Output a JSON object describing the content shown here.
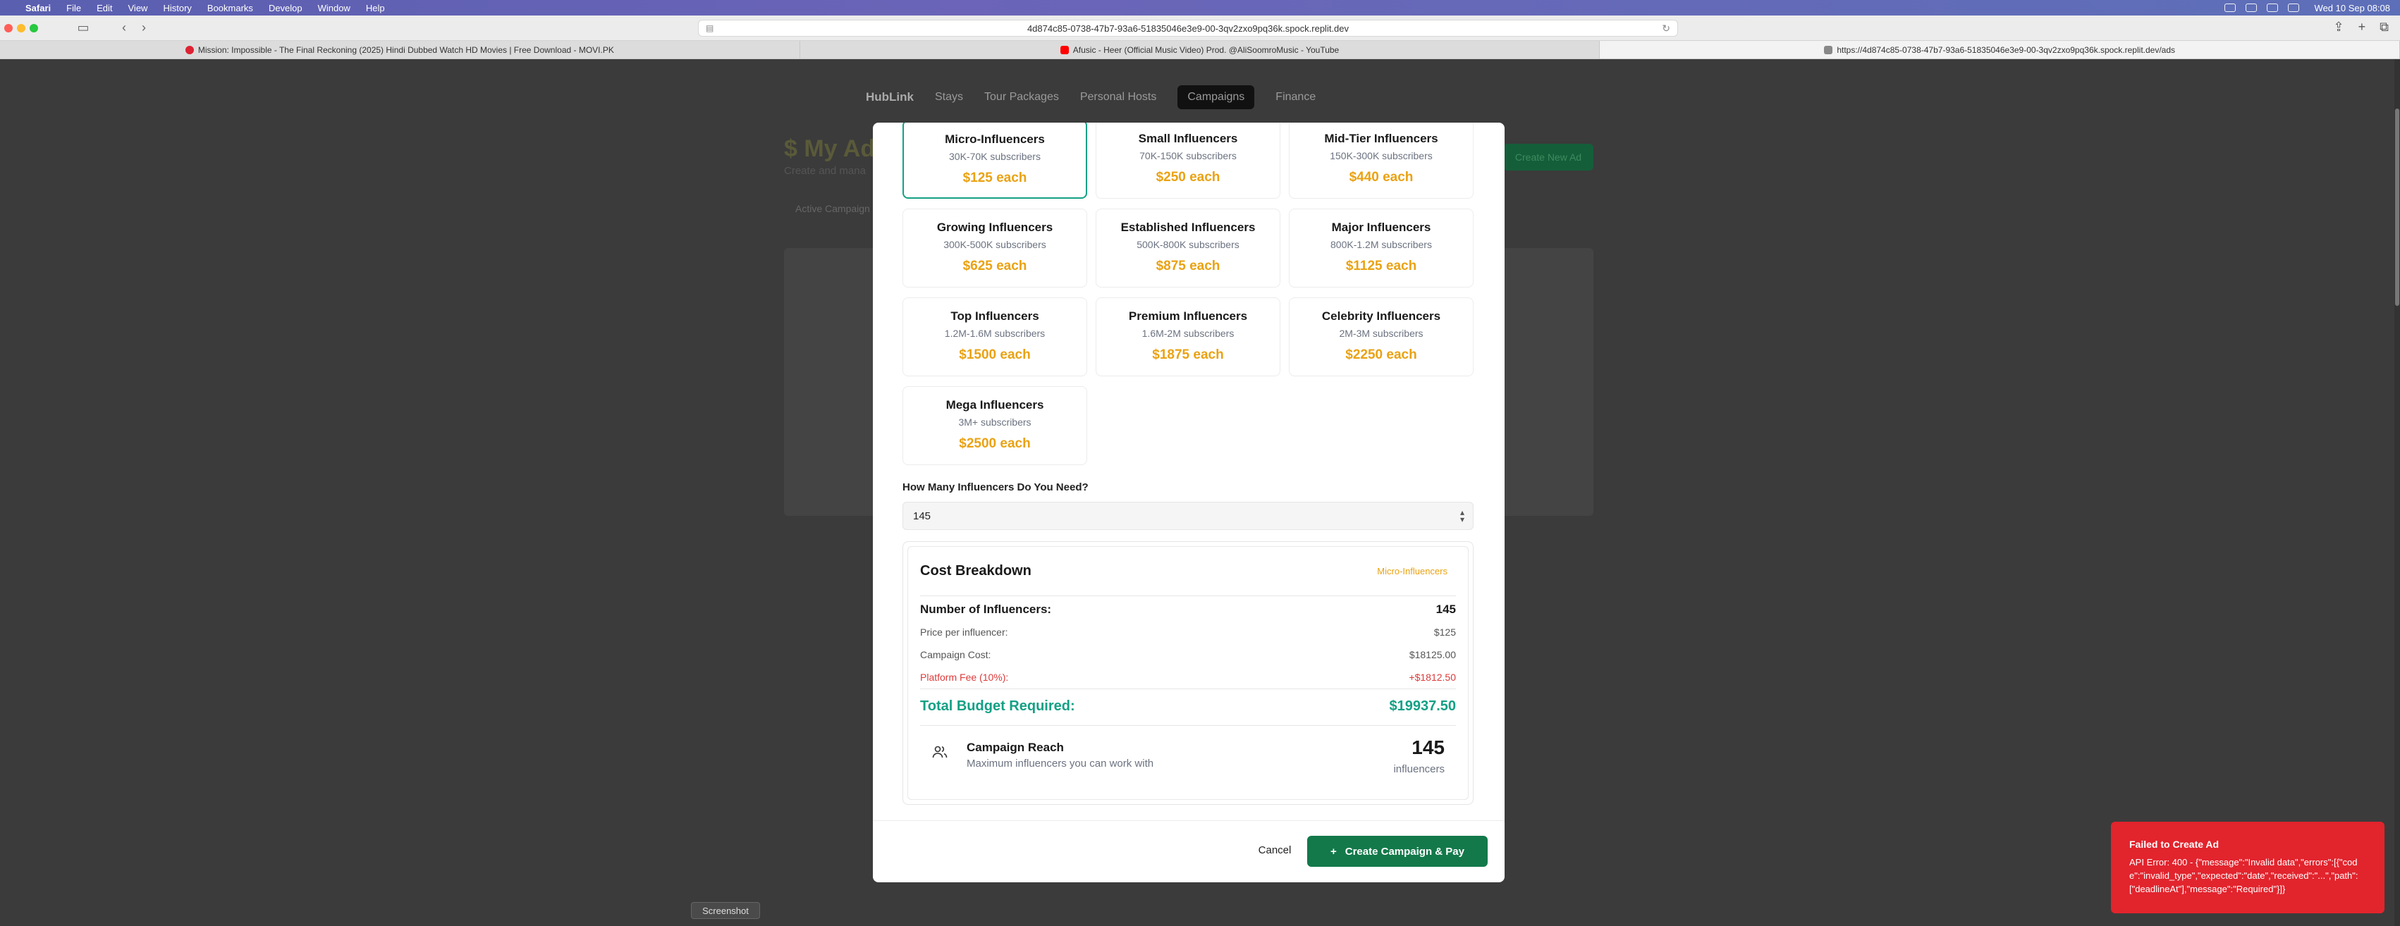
{
  "menubar": {
    "app": "Safari",
    "items": [
      "File",
      "Edit",
      "View",
      "History",
      "Bookmarks",
      "Develop",
      "Window",
      "Help"
    ],
    "clock": "Wed 10 Sep  08:08"
  },
  "browser": {
    "url": "4d874c85-0738-47b7-93a6-51835046e3e9-00-3qv2zxo9pq36k.spock.replit.dev",
    "tabs": [
      "Mission: Impossible - The Final Reckoning (2025) Hindi Dubbed Watch HD Movies | Free Download - MOVI.PK",
      "Afusic - Heer (Official Music Video) Prod. @AliSoomroMusic - YouTube",
      "https://4d874c85-0738-47b7-93a6-51835046e3e9-00-3qv2zxo9pq36k.spock.replit.dev/ads"
    ]
  },
  "nav": {
    "logo": "HubLink",
    "items": [
      "Stays",
      "Tour Packages",
      "Personal Hosts",
      "Campaigns",
      "Finance"
    ]
  },
  "page": {
    "title": "$ My Ad",
    "subtitle": "Create and mana",
    "tab": "Active Campaign",
    "create_button": "Create New Ad"
  },
  "tiers": [
    {
      "name": "Micro-Influencers",
      "subs": "30K-70K subscribers",
      "price": "$125 each"
    },
    {
      "name": "Small Influencers",
      "subs": "70K-150K subscribers",
      "price": "$250 each"
    },
    {
      "name": "Mid-Tier Influencers",
      "subs": "150K-300K subscribers",
      "price": "$440 each"
    },
    {
      "name": "Growing Influencers",
      "subs": "300K-500K subscribers",
      "price": "$625 each"
    },
    {
      "name": "Established Influencers",
      "subs": "500K-800K subscribers",
      "price": "$875 each"
    },
    {
      "name": "Major Influencers",
      "subs": "800K-1.2M subscribers",
      "price": "$1125 each"
    },
    {
      "name": "Top Influencers",
      "subs": "1.2M-1.6M subscribers",
      "price": "$1500 each"
    },
    {
      "name": "Premium Influencers",
      "subs": "1.6M-2M subscribers",
      "price": "$1875 each"
    },
    {
      "name": "Celebrity Influencers",
      "subs": "2M-3M subscribers",
      "price": "$2250 each"
    },
    {
      "name": "Mega Influencers",
      "subs": "3M+ subscribers",
      "price": "$2500 each"
    }
  ],
  "quantity": {
    "label": "How Many Influencers Do You Need?",
    "value": "145"
  },
  "cost": {
    "title": "Cost Breakdown",
    "tier": "Micro-Influencers",
    "num_label": "Number of Influencers:",
    "num_value": "145",
    "price_label": "Price per influencer:",
    "price_value": "$125",
    "campaign_label": "Campaign Cost:",
    "campaign_value": "$18125.00",
    "fee_label": "Platform Fee (10%):",
    "fee_value": "+$1812.50",
    "total_label": "Total Budget Required:",
    "total_value": "$19937.50",
    "reach_title": "Campaign Reach",
    "reach_sub": "Maximum influencers you can work with",
    "reach_value": "145",
    "reach_unit": "influencers"
  },
  "footer": {
    "cancel": "Cancel",
    "create": "Create Campaign & Pay"
  },
  "toast": {
    "title": "Failed to Create Ad",
    "message": "API Error: 400 - {\"message\":\"Invalid data\",\"errors\":[{\"code\":\"invalid_type\",\"expected\":\"date\",\"received\":\"...\",\"path\":[\"deadlineAt\"],\"message\":\"Required\"}]}"
  },
  "screenshot_label": "Screenshot",
  "colors": {
    "accent": "#14a085",
    "price": "#eaa212",
    "primary_button": "#13794a",
    "error": "#e2242d"
  }
}
